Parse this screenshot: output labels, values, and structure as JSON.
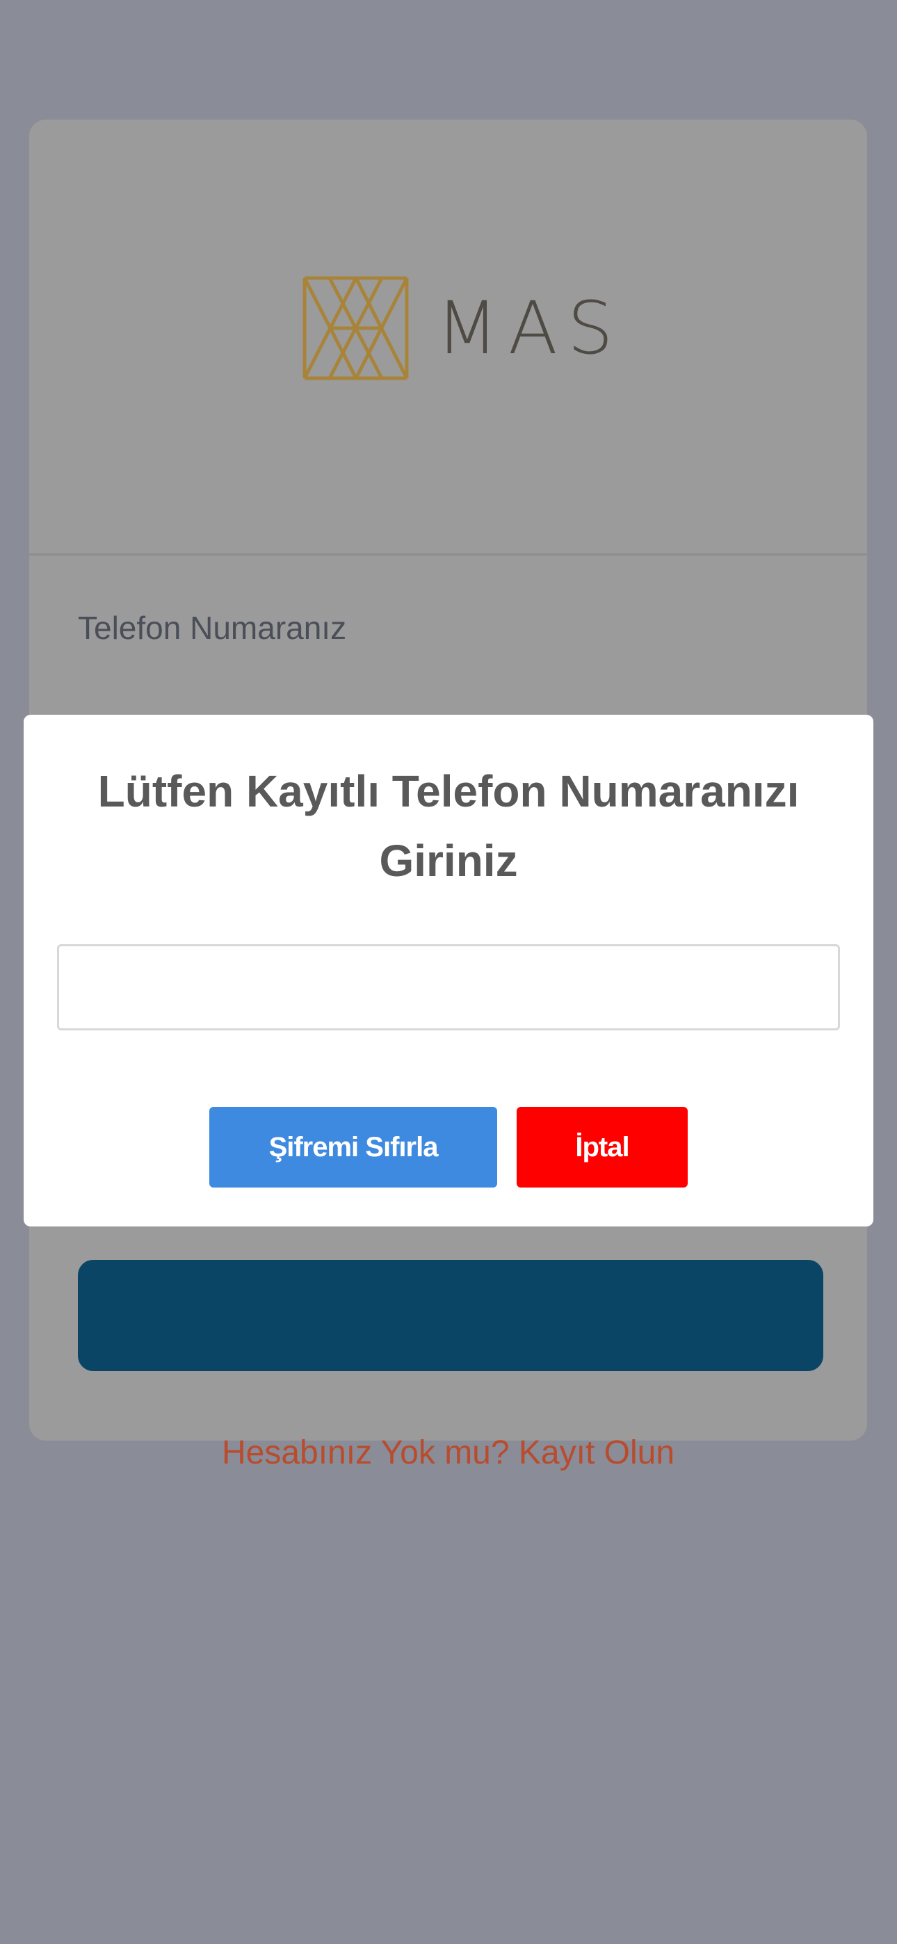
{
  "login_card": {
    "logo": {
      "brand_text": "MAS",
      "icon": "mas-geometric-logo-icon",
      "color": "#a8843a"
    },
    "phone_label": "Telefon Numaranız",
    "register_link": "Hesabınız Yok mu? Kayıt Olun"
  },
  "modal": {
    "title": "Lütfen Kayıtlı Telefon Numaranızı Giriniz",
    "input_value": "",
    "confirm_label": "Şifremi Sıfırla",
    "cancel_label": "İptal"
  },
  "colors": {
    "overlay_background": "#8a8c98",
    "confirm_button": "#3e8ae0",
    "cancel_button": "#ff0000",
    "login_button": "#0b4566",
    "link": "#b84c2c"
  }
}
